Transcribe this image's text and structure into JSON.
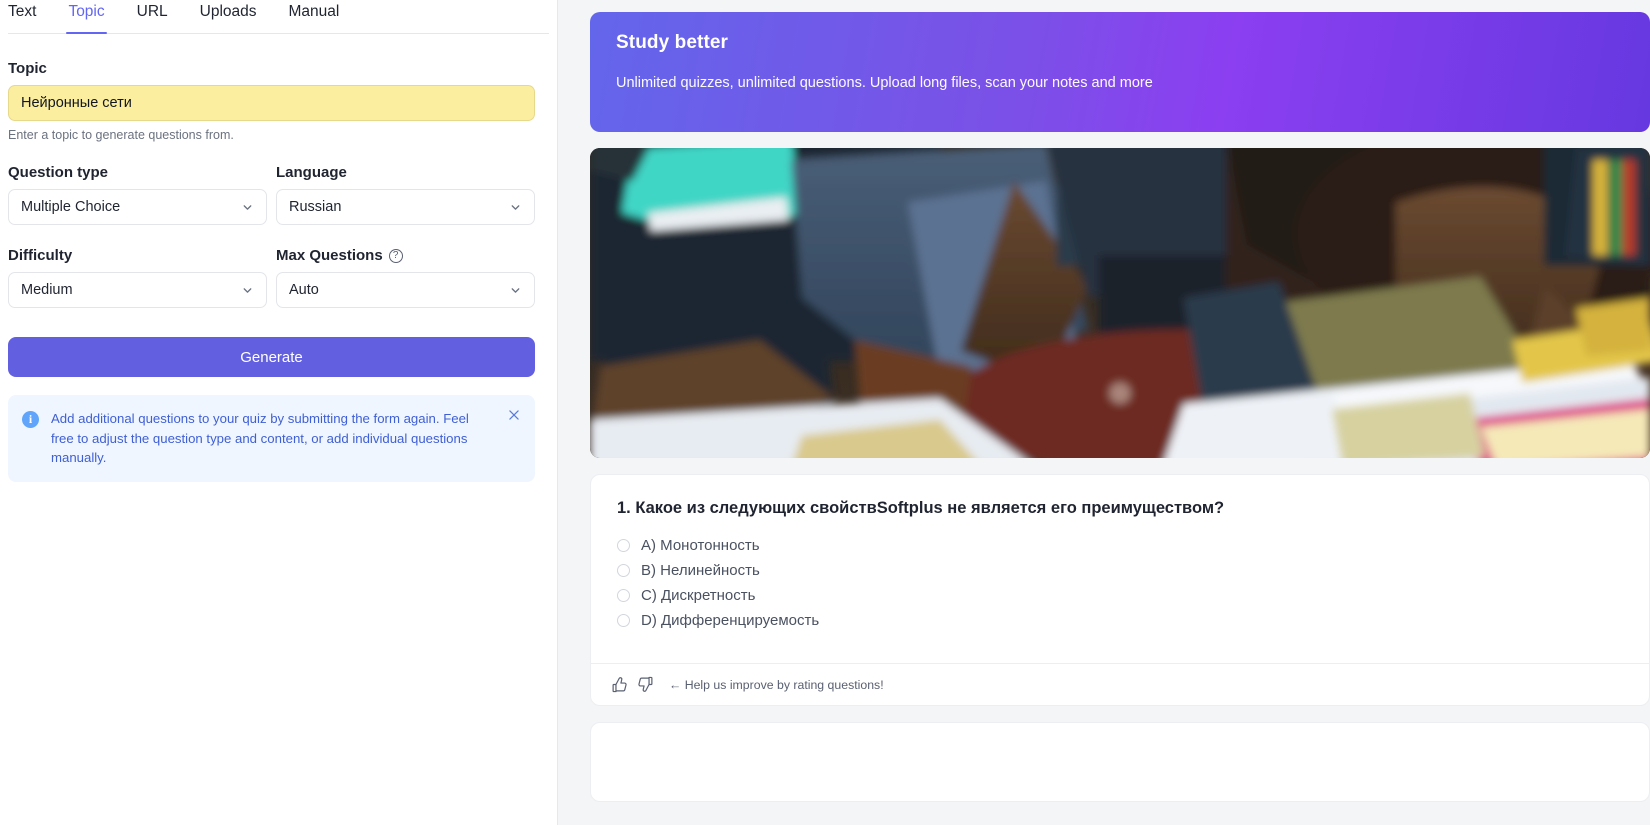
{
  "tabs": [
    {
      "label": "Text",
      "active": false
    },
    {
      "label": "Topic",
      "active": true
    },
    {
      "label": "URL",
      "active": false
    },
    {
      "label": "Uploads",
      "active": false
    },
    {
      "label": "Manual",
      "active": false
    }
  ],
  "form": {
    "topic_label": "Topic",
    "topic_value": "Нейронные сети",
    "topic_placeholder": "Enter a topic",
    "topic_help": "Enter a topic to generate questions from.",
    "question_type_label": "Question type",
    "question_type_value": "Multiple Choice",
    "language_label": "Language",
    "language_value": "Russian",
    "difficulty_label": "Difficulty",
    "difficulty_value": "Medium",
    "max_questions_label": "Max Questions",
    "max_questions_value": "Auto",
    "generate_label": "Generate"
  },
  "alert": {
    "line1": "Add additional questions to your quiz by submitting the form again.",
    "line2": "Feel free to adjust the question type and content, or add individual",
    "line3": "questions manually."
  },
  "banner": {
    "title": "Study better",
    "subtitle": "Unlimited quizzes, unlimited questions. Upload long files, scan your notes and more",
    "gradient_start": "#6366ea",
    "gradient_end": "#8b3ff0"
  },
  "quiz": {
    "question_text": "1. Какое из следующих свойствSoftplus не является его преимуществом?",
    "options": [
      "A) Монотонность",
      "B) Нелинейность",
      "C) Дискретность",
      "D) Дифференцируемость"
    ],
    "rating_prompt": "← Help us improve by rating questions!"
  },
  "accent_color": "#6366f1"
}
